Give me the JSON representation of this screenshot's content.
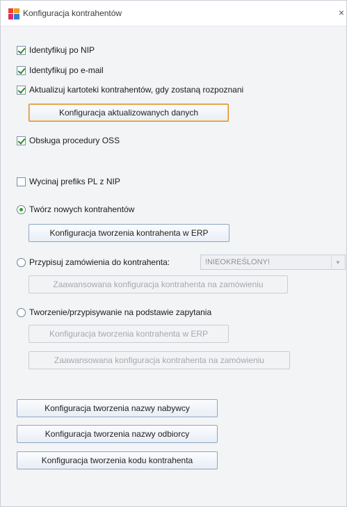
{
  "window": {
    "title": "Konfiguracja kontrahentów",
    "close_glyph": "×"
  },
  "options": {
    "identify_nip": {
      "label": "Identyfikuj po NIP",
      "checked": true
    },
    "identify_email": {
      "label": "Identyfikuj po e-mail",
      "checked": true
    },
    "update_cards": {
      "label": "Aktualizuj kartoteki kontrahentów, gdy zostaną rozpoznani",
      "checked": true
    },
    "oss": {
      "label": "Obsługa procedury OSS",
      "checked": true
    },
    "strip_pl_prefix": {
      "label": "Wycinaj prefiks PL z NIP",
      "checked": false
    }
  },
  "buttons": {
    "updated_data_config": "Konfiguracja aktualizowanych danych",
    "create_in_erp": "Konfiguracja tworzenia kontrahenta w ERP",
    "advanced_order_config": "Zaawansowana konfiguracja kontrahenta na zamówieniu",
    "create_in_erp_query": "Konfiguracja tworzenia kontrahenta w ERP",
    "advanced_order_config_query": "Zaawansowana konfiguracja kontrahenta na zamówieniu",
    "buyer_name_config": "Konfiguracja tworzenia nazwy nabywcy",
    "recipient_name_config": "Konfiguracja tworzenia nazwy odbiorcy",
    "contractor_code_config": "Konfiguracja tworzenia kodu kontrahenta"
  },
  "mode": {
    "create_new": {
      "label": "Twórz nowych kontrahentów",
      "selected": true
    },
    "assign_orders": {
      "label": "Przypisuj zamówienia do kontrahenta:",
      "selected": false
    },
    "by_query": {
      "label": "Tworzenie/przypisywanie na podstawie zapytania",
      "selected": false
    }
  },
  "contractor_select": {
    "value": "!NIEOKREŚLONY!"
  },
  "colors": {
    "focus_border": "#d98b1f",
    "check_green": "#2c8a2c",
    "button_border": "#8ea6c4"
  }
}
